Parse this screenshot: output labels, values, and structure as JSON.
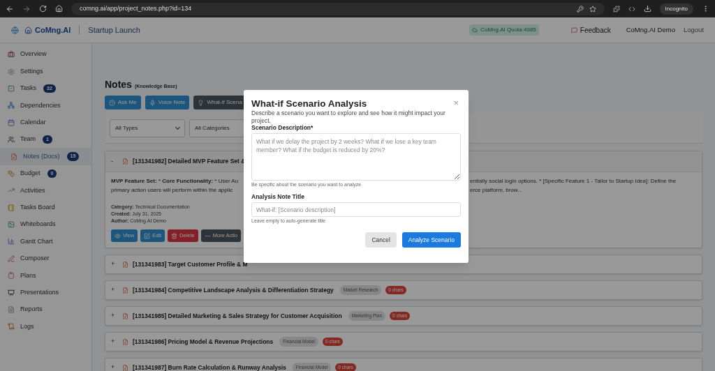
{
  "browser": {
    "url": "comng.ai/app/project_notes.php?id=134",
    "profile": "Incognito"
  },
  "header": {
    "brand": "CoMng.AI",
    "project": "Startup Launch",
    "quota": "CoMng.AI Quota:4985",
    "feedback": "Feedback",
    "user": "CoMng.AI Demo",
    "logout": "Logout"
  },
  "sidebar": {
    "items": [
      {
        "label": "Overview",
        "selected": false
      },
      {
        "label": "Settings",
        "selected": false
      },
      {
        "label": "Tasks",
        "selected": false,
        "badge": "32"
      },
      {
        "label": "Dependencies",
        "selected": false
      },
      {
        "label": "Calendar",
        "selected": false
      },
      {
        "label": "Team",
        "selected": false,
        "badge": "1"
      },
      {
        "label": "Notes (Docs)",
        "selected": true,
        "badge": "15"
      },
      {
        "label": "Budget",
        "selected": false,
        "badge": "0"
      },
      {
        "label": "Activities",
        "selected": false
      },
      {
        "label": "Tasks Board",
        "selected": false
      },
      {
        "label": "Whiteboards",
        "selected": false
      },
      {
        "label": "Gantt Chart",
        "selected": false
      },
      {
        "label": "Composer",
        "selected": false
      },
      {
        "label": "Plans",
        "selected": false
      },
      {
        "label": "Presentations",
        "selected": false
      },
      {
        "label": "Reports",
        "selected": false
      },
      {
        "label": "Logs",
        "selected": false
      }
    ]
  },
  "page": {
    "title": "Notes",
    "subtitle": "(Knowledge Base)",
    "actions": [
      {
        "label": "Ask Me",
        "kind": "ask"
      },
      {
        "label": "Voice Note",
        "kind": "voice"
      },
      {
        "label": "What-if Scena",
        "kind": "whatif"
      }
    ],
    "filters": [
      "All Types",
      "All Categories"
    ]
  },
  "notes": [
    {
      "toggle": "-",
      "title": "[131341982] Detailed MVP Feature Set &",
      "expanded": true,
      "body_left": [
        "**MVP Feature Set:** * **Core Functionality:** * User Au",
        "primary action users will perform within the applic"
      ],
      "body_right": [
        "entially social login options. * [Specific Feature 1 - Tailor to Startup Idea]: Define the",
        "erce platform, brow..."
      ],
      "meta": [
        "**Category:** Technical Documentation",
        "**Created:** July 31, 2025",
        "**Author:** CoMng.AI Demo"
      ],
      "buttons": [
        {
          "label": "View",
          "kind": "view"
        },
        {
          "label": "Edit",
          "kind": "edit"
        },
        {
          "label": "Delete",
          "kind": "delete"
        },
        {
          "label": "More Actio",
          "kind": "more"
        }
      ]
    },
    {
      "toggle": "+",
      "title": "[131341983] Target Customer Profile & M",
      "expanded": false
    },
    {
      "toggle": "+",
      "title": "[131341984] Competitive Landscape Analysis & Differentiation Strategy",
      "expanded": false,
      "category": "Market Research",
      "size": "0 chars"
    },
    {
      "toggle": "+",
      "title": "[131341985] Detailed Marketing & Sales Strategy for Customer Acquisition",
      "expanded": false,
      "category": "Marketing Plan",
      "size": "0 chars"
    },
    {
      "toggle": "+",
      "title": "[131341986] Pricing Model & Revenue Projections",
      "expanded": false,
      "category": "Financial Model",
      "size": "0 chars"
    },
    {
      "toggle": "+",
      "title": "[131341987] Burn Rate Calculation & Runway Analysis",
      "expanded": false,
      "category": "Financial Model",
      "size": "0 chars"
    }
  ],
  "modal": {
    "title": "What-if Scenario Analysis",
    "close": "×",
    "description": "Describe a scenario you want to explore and see how it might impact your project.",
    "fields": [
      {
        "label": "Scenario Description*",
        "kind": "textarea",
        "placeholder": "What if we delay the project by 2 weeks? What if we lose a key team member? What if the budget is reduced by 20%?",
        "help": "Be specific about the scenario you want to analyze"
      },
      {
        "label": "Analysis Note Title",
        "kind": "input",
        "placeholder": "What-if: [Scenario description]",
        "help": "Leave empty to auto-generate title"
      }
    ],
    "buttons": [
      {
        "label": "Cancel",
        "kind": "secondary"
      },
      {
        "label": "Analyze Scenario",
        "kind": "primary"
      }
    ]
  }
}
